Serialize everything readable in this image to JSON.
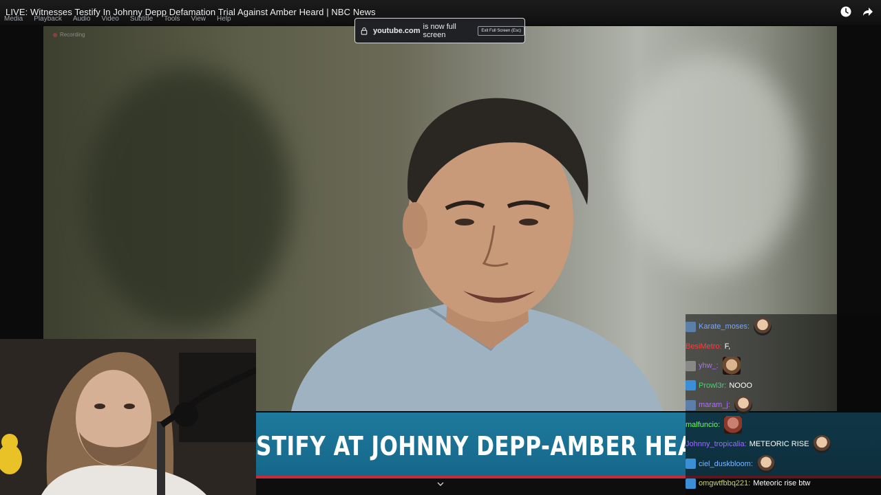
{
  "video": {
    "title": "LIVE: Witnesses Testify In Johnny Depp Defamation Trial Against Amber Heard | NBC News",
    "recording_label": "Recording"
  },
  "menu": [
    "Media",
    "Playback",
    "Audio",
    "Video",
    "Subtitle",
    "Tools",
    "View",
    "Help"
  ],
  "fullscreen_notice": {
    "domain": "youtube.com",
    "message": "is now full screen",
    "exit_label": "Exit Full Screen (Esc)"
  },
  "chyron": {
    "text": "STIFY AT JOHNNY DEPP-AMBER HEARD"
  },
  "chat": {
    "messages": [
      {
        "user": "Karate_moses:",
        "color": "#7aa7ff",
        "text": "",
        "badge": "#5b7fa8",
        "emote": "face"
      },
      {
        "user": "BesiMetro:",
        "color": "#ff3d3d",
        "text": "F,",
        "badge": "",
        "emote": ""
      },
      {
        "user": "yhw_:",
        "color": "#b26cff",
        "text": "",
        "badge": "#888888",
        "emote": "tan"
      },
      {
        "user": "Prowl3r:",
        "color": "#45d56e",
        "text": "NOOO",
        "badge": "#3a8fd6",
        "emote": ""
      },
      {
        "user": "maram_j:",
        "color": "#b26cff",
        "text": "",
        "badge": "#5b7fa8",
        "emote": "face"
      },
      {
        "user": "malfuncio:",
        "color": "#6dff5a",
        "text": "",
        "badge": "",
        "emote": "red"
      },
      {
        "user": "Johnny_tropicalia:",
        "color": "#9b6bff",
        "text": "METEORIC RISE",
        "badge": "",
        "emote": "face"
      },
      {
        "user": "ciel_duskbloom:",
        "color": "#7ab8ff",
        "text": "",
        "badge": "#3a8fd6",
        "emote": "face"
      },
      {
        "user": "omgwtfbbq221:",
        "color": "#c9d36b",
        "text": "Meteoric rise btw",
        "badge": "#3a8fd6",
        "emote": ""
      }
    ]
  },
  "colors": {
    "chyron_blue": "#1d7a9c",
    "chyron_red": "#c42b3b"
  },
  "icons": [
    "watch-later-icon",
    "share-icon",
    "lock-icon",
    "chevron-down-icon"
  ]
}
